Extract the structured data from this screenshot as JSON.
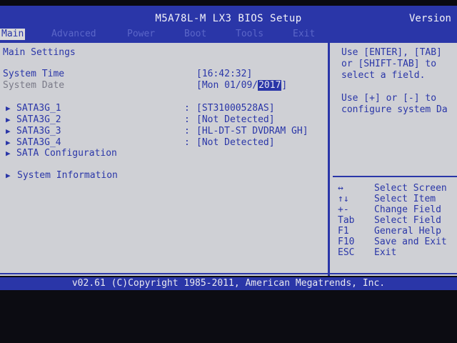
{
  "header": {
    "title": "M5A78L-M LX3 BIOS Setup",
    "version": "Version"
  },
  "menu": {
    "main": "Main",
    "advanced": "Advanced",
    "power": "Power",
    "boot": "Boot",
    "tools": "Tools",
    "exit": "Exit"
  },
  "main": {
    "section_title": "Main Settings",
    "system_time_label": "System Time",
    "system_time_value": "[16:42:32]",
    "system_date_label": "System Date",
    "system_date_prefix": "[Mon 01/09/",
    "system_date_year": "2017",
    "system_date_suffix": "]",
    "sata1_label": "SATA3G_1",
    "sata1_value": "[ST31000528AS]",
    "sata2_label": "SATA3G_2",
    "sata2_value": "[Not Detected]",
    "sata3_label": "SATA3G_3",
    "sata3_value": "[HL-DT-ST DVDRAM GH]",
    "sata4_label": "SATA3G_4",
    "sata4_value": "[Not Detected]",
    "sata_config_label": "SATA Configuration",
    "system_info_label": "System Information",
    "colon": ":"
  },
  "help": {
    "line1": "Use [ENTER], [TAB]",
    "line2": "or [SHIFT-TAB] to",
    "line3": "select a field.",
    "line4": "Use [+] or [-] to",
    "line5": "configure system Da",
    "keys": [
      {
        "key": "↔",
        "desc": "Select Screen"
      },
      {
        "key": "↑↓",
        "desc": "Select Item"
      },
      {
        "key": "+-",
        "desc": "Change Field"
      },
      {
        "key": "Tab",
        "desc": "Select Field"
      },
      {
        "key": "F1",
        "desc": "General Help"
      },
      {
        "key": "F10",
        "desc": "Save and Exit"
      },
      {
        "key": "ESC",
        "desc": "Exit"
      }
    ]
  },
  "footer": {
    "text": "v02.61 (C)Copyright 1985-2011, American Megatrends, Inc."
  },
  "icons": {
    "submenu_arrow": "▶"
  }
}
